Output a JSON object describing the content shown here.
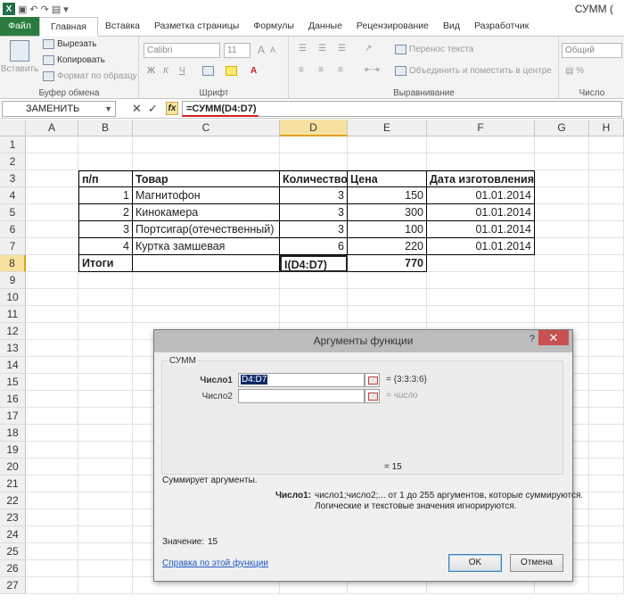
{
  "window": {
    "title": "СУММ ("
  },
  "quick_access": {
    "save_icon": "save-icon",
    "undo_icon": "undo-icon",
    "redo_icon": "redo-icon"
  },
  "tabs": [
    "Файл",
    "Главная",
    "Вставка",
    "Разметка страницы",
    "Формулы",
    "Данные",
    "Рецензирование",
    "Вид",
    "Разработчик"
  ],
  "ribbon": {
    "clipboard": {
      "paste": "Вставить",
      "cut": "Вырезать",
      "copy": "Копировать",
      "format_painter": "Формат по образцу",
      "label": "Буфер обмена"
    },
    "font": {
      "name": "Calibri",
      "size": "11",
      "bold": "Ж",
      "italic": "К",
      "underline": "Ч",
      "grow": "A",
      "shrink": "A",
      "color": "A",
      "label": "Шрифт"
    },
    "alignment": {
      "wrap": "Перенос текста",
      "merge": "Объединить и поместить в центре",
      "label": "Выравнивание"
    },
    "number": {
      "format": "Общий",
      "label": "Число"
    }
  },
  "formula_bar": {
    "name_box": "ЗАМЕНИТЬ",
    "cancel": "✕",
    "enter": "✓",
    "fx": "fx",
    "formula": "=СУММ(D4:D7)"
  },
  "columns": [
    "A",
    "B",
    "C",
    "D",
    "E",
    "F",
    "G",
    "H"
  ],
  "rows": [
    "1",
    "2",
    "3",
    "4",
    "5",
    "6",
    "7",
    "8",
    "9",
    "10",
    "11",
    "12",
    "13",
    "14",
    "15",
    "16",
    "17",
    "18",
    "19",
    "20",
    "21",
    "22",
    "23",
    "24",
    "25",
    "26",
    "27"
  ],
  "table": {
    "headers": [
      "п/п",
      "Товар",
      "Количество",
      "Цена",
      "Дата изготовления"
    ],
    "rows": [
      [
        "1",
        "Магнитофон",
        "3",
        "150",
        "01.01.2014"
      ],
      [
        "2",
        "Кинокамера",
        "3",
        "300",
        "01.01.2014"
      ],
      [
        "3",
        "Портсигар(отечественный)",
        "3",
        "100",
        "01.01.2014"
      ],
      [
        "4",
        "Куртка замшевая",
        "6",
        "220",
        "01.01.2014"
      ]
    ],
    "totals": {
      "label": "Итоги",
      "qty": "І(D4:D7)",
      "price": "770"
    }
  },
  "dialog": {
    "title": "Аргументы функции",
    "help_glyph": "?",
    "close_glyph": "✕",
    "function": "СУММ",
    "arg1_label": "Число1",
    "arg1_value": "D4:D7",
    "arg1_result": "= {3:3:3:6}",
    "arg2_label": "Число2",
    "arg2_result": "= число",
    "total_result": "=   15",
    "description": "Суммирует аргументы.",
    "arg_help_label": "Число1:",
    "arg_help_line1": "число1;число2;... от 1 до 255 аргументов, которые суммируются.",
    "arg_help_line2": "Логические и текстовые значения игнорируются.",
    "value_label": "Значение:",
    "value": "15",
    "help_link": "Справка по этой функции",
    "ok": "OK",
    "cancel": "Отмена"
  }
}
